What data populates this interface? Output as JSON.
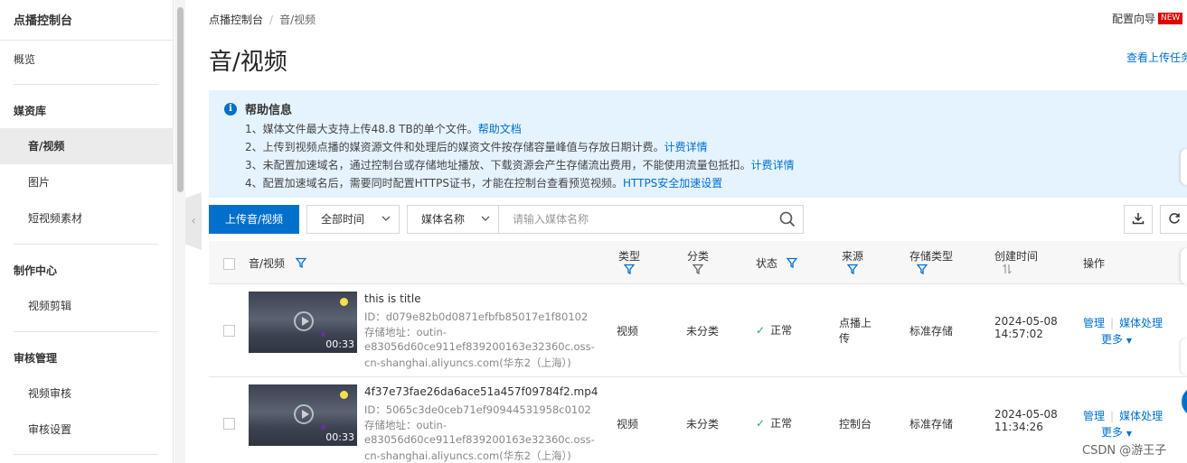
{
  "sidebar": {
    "title": "点播控制台",
    "items": [
      {
        "label": "概览"
      },
      {
        "label": "媒资库"
      },
      {
        "label": "音/视频"
      },
      {
        "label": "图片"
      },
      {
        "label": "短视频素材"
      },
      {
        "label": "制作中心"
      },
      {
        "label": "视频剪辑"
      },
      {
        "label": "审核管理"
      },
      {
        "label": "视频审核"
      },
      {
        "label": "审核设置"
      }
    ]
  },
  "breadcrumb": {
    "root": "点播控制台",
    "sep": "/",
    "current": "音/视频"
  },
  "header": {
    "title": "音/视频",
    "guide": "配置向导",
    "new_badge": "NEW",
    "upload_tasks": "查看上传任务"
  },
  "help": {
    "title": "帮助信息",
    "lines": [
      {
        "text": "1、媒体文件最大支持上传48.8 TB的单个文件。",
        "link": "帮助文档"
      },
      {
        "text": "2、上传到视频点播的媒资源文件和处理后的媒资文件按存储容量峰值与存放日期计费。",
        "link": "计费详情"
      },
      {
        "text": "3、未配置加速域名，通过控制台或存储地址播放、下载资源会产生存储流出费用，不能使用流量包抵扣。",
        "link": "计费详情"
      },
      {
        "text": "4、配置加速域名后，需要同时配置HTTPS证书，才能在控制台查看预览视频。",
        "link": "HTTPS安全加速设置"
      }
    ]
  },
  "toolbar": {
    "upload_label": "上传音/视频",
    "time_filter": "全部时间",
    "field_select": "媒体名称",
    "search_placeholder": "请输入媒体名称"
  },
  "table": {
    "columns": {
      "media": "音/视频",
      "type": "类型",
      "category": "分类",
      "status": "状态",
      "source": "来源",
      "storage": "存储类型",
      "created": "创建时间",
      "actions": "操作"
    },
    "rows": [
      {
        "title": "this is title",
        "id": "ID：d079e82b0d0871efbfb85017e1f80102",
        "storage_line1": "存储地址：outin-",
        "storage_line2": "e83056d60ce911ef839200163e32360c.oss-",
        "storage_line3": "cn-shanghai.aliyuncs.com(华东2（上海）)",
        "duration": "00:33",
        "type": "视频",
        "category": "未分类",
        "status": "正常",
        "source_line1": "点播上",
        "source_line2": "传",
        "storage_type": "标准存储",
        "date": "2024-05-08",
        "time": "14:57:02",
        "op_manage": "管理",
        "op_process": "媒体处理",
        "op_more": "更多"
      },
      {
        "title": "4f37e73fae26da6ace51a457f09784f2.mp4",
        "id": "ID：5065c3de0ceb71ef90944531958c0102",
        "storage_line1": "存储地址：outin-",
        "storage_line2": "e83056d60ce911ef839200163e32360c.oss-",
        "storage_line3": "cn-shanghai.aliyuncs.com(华东2（上海）)",
        "duration": "00:33",
        "type": "视频",
        "category": "未分类",
        "status": "正常",
        "source_line1": "控制台",
        "source_line2": "",
        "storage_type": "标准存储",
        "date": "2024-05-08",
        "time": "11:34:26",
        "op_manage": "管理",
        "op_process": "媒体处理",
        "op_more": "更多"
      }
    ]
  },
  "watermark": "CSDN @游王子",
  "colors": {
    "accent": "#0070cc",
    "help_bg": "#e5f3ff",
    "success": "#2ba471",
    "badge": "#dd0000"
  }
}
